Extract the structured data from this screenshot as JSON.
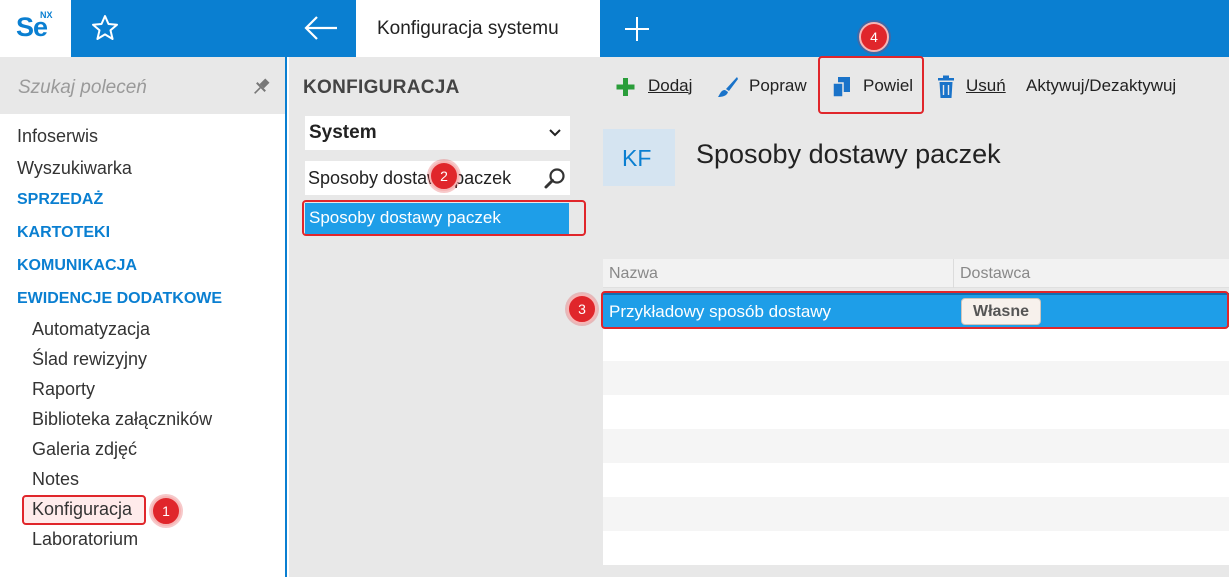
{
  "app": {
    "logo_text": "Se",
    "logo_superscript": "NX"
  },
  "tabs": {
    "active_label": "Konfiguracja systemu"
  },
  "sidebar": {
    "search_placeholder": "Szukaj poleceń",
    "items": [
      {
        "label": "Infoserwis",
        "type": "item"
      },
      {
        "label": "Wyszukiwarka",
        "type": "item"
      },
      {
        "label": "SPRZEDAŻ",
        "type": "category"
      },
      {
        "label": "KARTOTEKI",
        "type": "category"
      },
      {
        "label": "KOMUNIKACJA",
        "type": "category"
      },
      {
        "label": "EWIDENCJE DODATKOWE",
        "type": "category"
      },
      {
        "label": "Automatyzacja",
        "type": "subitem"
      },
      {
        "label": "Ślad rewizyjny",
        "type": "subitem"
      },
      {
        "label": "Raporty",
        "type": "subitem"
      },
      {
        "label": "Biblioteka załączników",
        "type": "subitem"
      },
      {
        "label": "Galeria zdjęć",
        "type": "subitem"
      },
      {
        "label": "Notes",
        "type": "subitem"
      },
      {
        "label": "Konfiguracja",
        "type": "subitem"
      },
      {
        "label": "Laboratorium",
        "type": "subitem"
      }
    ]
  },
  "config_panel": {
    "title": "KONFIGURACJA",
    "dropdown_value": "System",
    "filter_value": "Sposoby dostawy paczek",
    "selected_item": "Sposoby dostawy paczek"
  },
  "toolbar": {
    "add": "Dodaj",
    "edit": "Popraw",
    "duplicate": "Powiel",
    "delete": "Usuń",
    "toggle": "Aktywuj/Dezaktywuj"
  },
  "page": {
    "badge": "KF",
    "title": "Sposoby dostawy paczek"
  },
  "grid": {
    "columns": [
      "Nazwa",
      "Dostawca"
    ],
    "rows": [
      {
        "name": "Przykładowy sposób dostawy",
        "supplier": "Własne"
      }
    ]
  },
  "annotations": [
    "1",
    "2",
    "3",
    "4"
  ],
  "colors": {
    "accent": "#0a7fd1",
    "selection": "#1e9ee8",
    "annotation": "#e0262b",
    "add_icon": "#2a9d3a"
  }
}
